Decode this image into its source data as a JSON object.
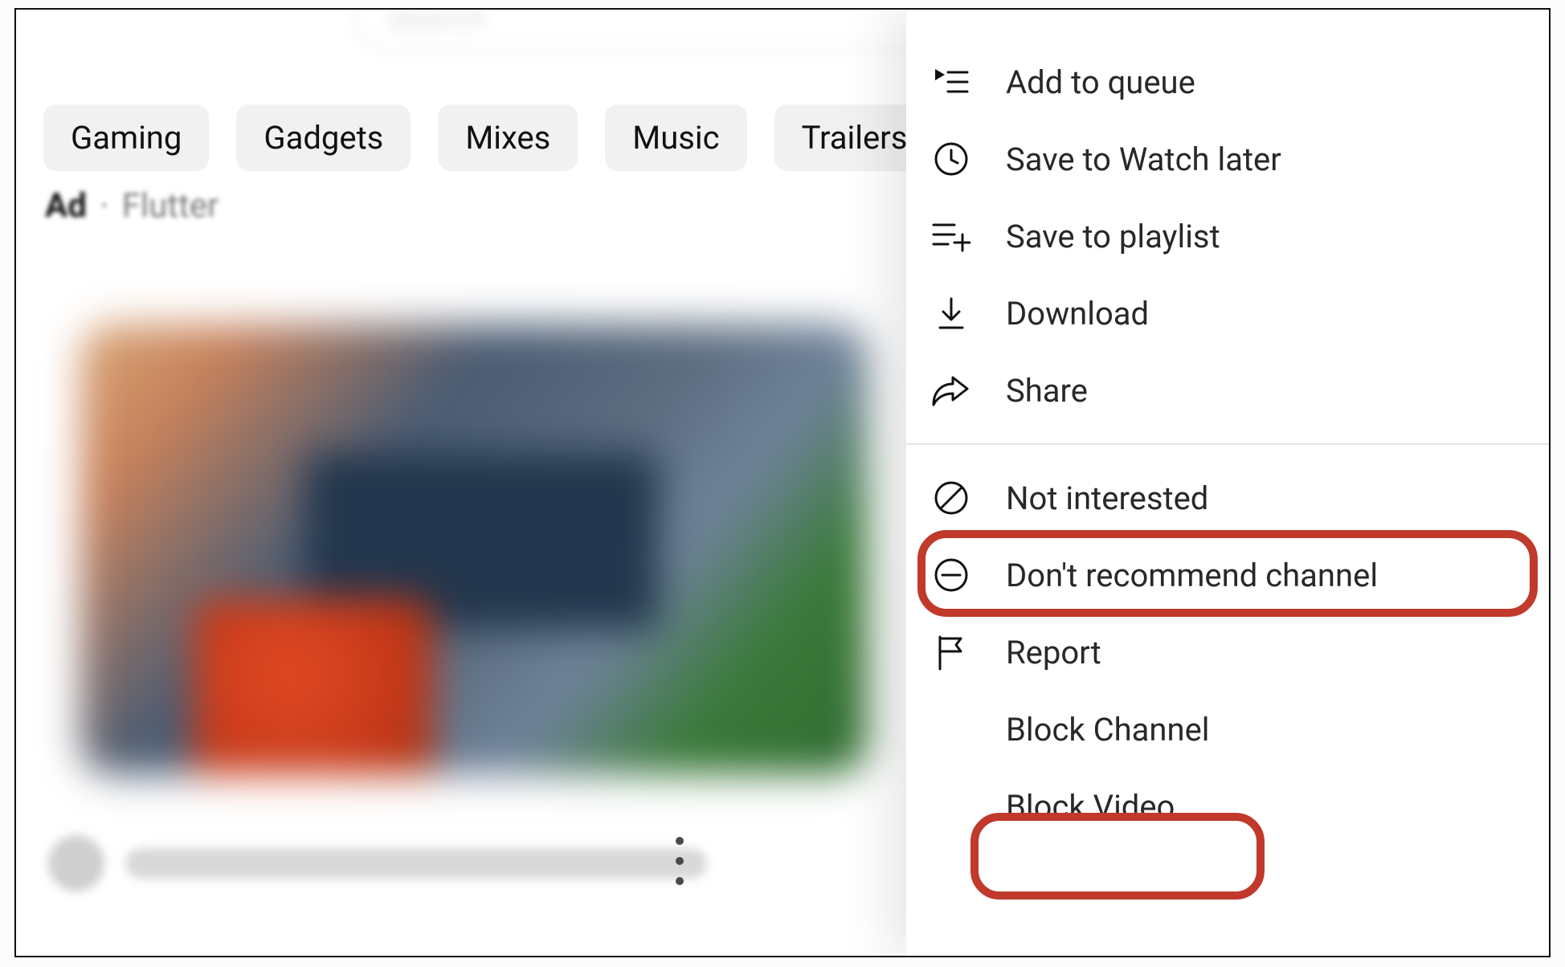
{
  "search": {
    "placeholder": "Search"
  },
  "chips": {
    "items": [
      {
        "label": "Gaming"
      },
      {
        "label": "Gadgets"
      },
      {
        "label": "Mixes"
      },
      {
        "label": "Music"
      },
      {
        "label": "Trailers"
      }
    ]
  },
  "byline": {
    "ad_label": "Ad",
    "separator": "·",
    "sponsor": "Flutter"
  },
  "menu": {
    "items": [
      {
        "icon": "queue-icon",
        "label": "Add to queue"
      },
      {
        "icon": "clock-icon",
        "label": "Save to Watch later"
      },
      {
        "icon": "playlist-add-icon",
        "label": "Save to playlist"
      },
      {
        "icon": "download-icon",
        "label": "Download"
      },
      {
        "icon": "share-icon",
        "label": "Share"
      }
    ],
    "items2": [
      {
        "icon": "not-interested-icon",
        "label": "Not interested"
      },
      {
        "icon": "dont-recommend-icon",
        "label": "Don't recommend channel",
        "highlighted": true
      },
      {
        "icon": "report-icon",
        "label": "Report"
      },
      {
        "icon": "",
        "label": "Block Channel"
      },
      {
        "icon": "",
        "label": "Block Video",
        "highlighted": true
      }
    ]
  },
  "highlight_color": "#c0392b"
}
